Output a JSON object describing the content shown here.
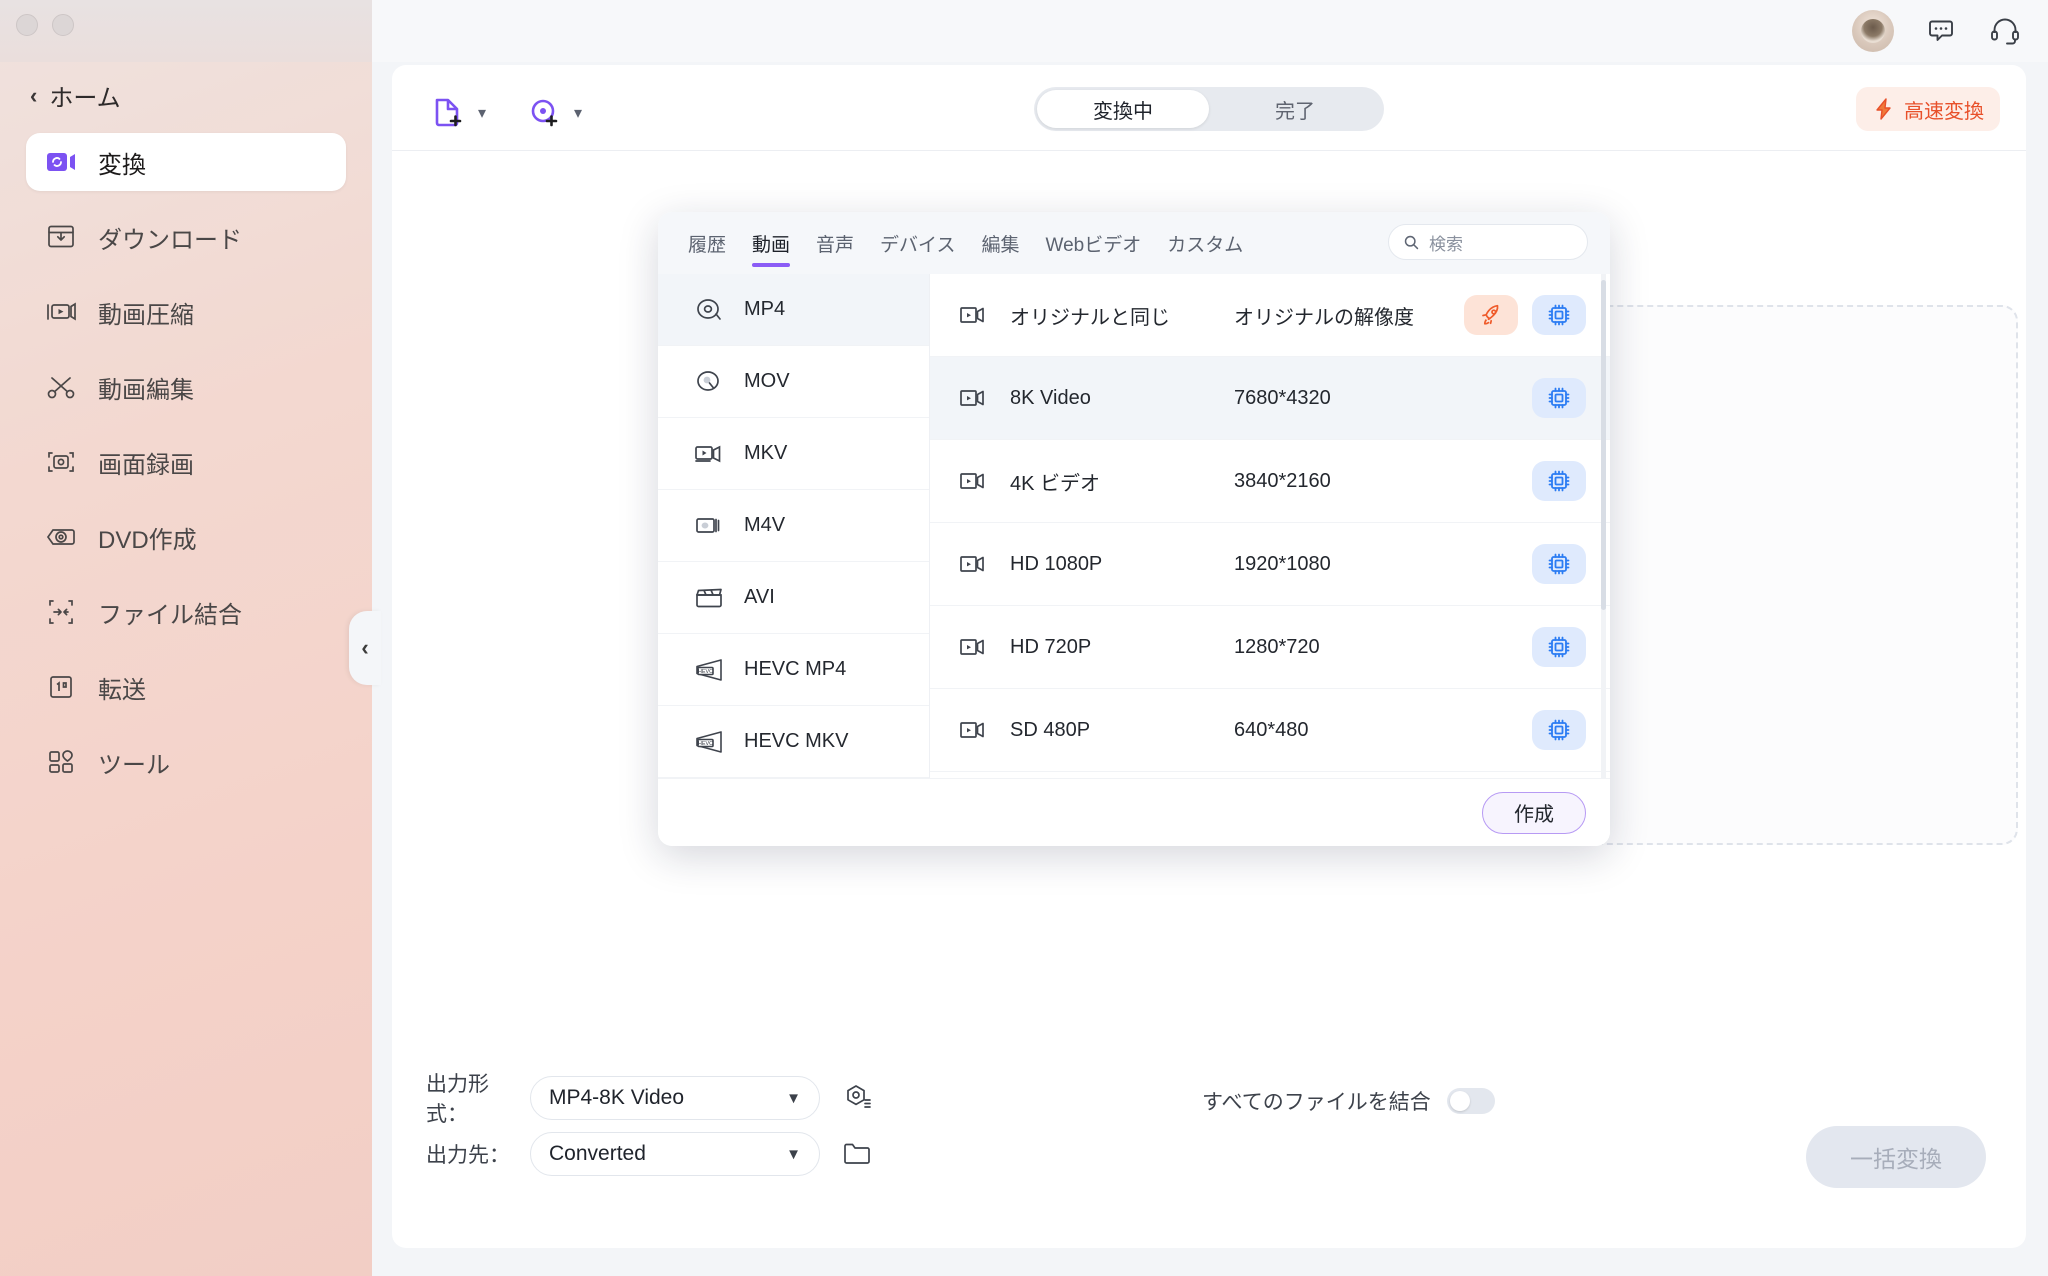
{
  "sidebar": {
    "back_label": "ホーム",
    "items": [
      {
        "label": "変換",
        "icon": "convert-icon",
        "active": true
      },
      {
        "label": "ダウンロード",
        "icon": "download-icon",
        "active": false
      },
      {
        "label": "動画圧縮",
        "icon": "compress-icon",
        "active": false
      },
      {
        "label": "動画編集",
        "icon": "scissors-icon",
        "active": false
      },
      {
        "label": "画面録画",
        "icon": "record-icon",
        "active": false
      },
      {
        "label": "DVD作成",
        "icon": "dvd-icon",
        "active": false
      },
      {
        "label": "ファイル結合",
        "icon": "merge-icon",
        "active": false
      },
      {
        "label": "転送",
        "icon": "transfer-icon",
        "active": false
      },
      {
        "label": "ツール",
        "icon": "tools-icon",
        "active": false
      }
    ]
  },
  "topbar": {
    "icons": [
      "avatar",
      "chat-icon",
      "headset-icon"
    ]
  },
  "toolbar": {
    "add_file_label": "add-file",
    "add_folder_label": "add-folder",
    "segments": [
      {
        "label": "変換中",
        "active": true
      },
      {
        "label": "完了",
        "active": false
      }
    ],
    "fast_convert_label": "高速変換"
  },
  "dialog": {
    "tabs": [
      {
        "label": "履歴",
        "active": false
      },
      {
        "label": "動画",
        "active": true
      },
      {
        "label": "音声",
        "active": false
      },
      {
        "label": "デバイス",
        "active": false
      },
      {
        "label": "編集",
        "active": false
      },
      {
        "label": "Webビデオ",
        "active": false
      },
      {
        "label": "カスタム",
        "active": false
      }
    ],
    "search_placeholder": "検索",
    "formats": [
      {
        "label": "MP4",
        "icon": "disc-icon",
        "active": true
      },
      {
        "label": "MOV",
        "icon": "mov-icon",
        "active": false
      },
      {
        "label": "MKV",
        "icon": "camcorder-icon",
        "active": false
      },
      {
        "label": "M4V",
        "icon": "m4v-icon",
        "active": false
      },
      {
        "label": "AVI",
        "icon": "clapper-icon",
        "active": false
      },
      {
        "label": "HEVC MP4",
        "icon": "hevc-icon",
        "active": false
      },
      {
        "label": "HEVC MKV",
        "icon": "hevc-icon",
        "active": false
      }
    ],
    "resolutions": [
      {
        "name": "オリジナルと同じ",
        "dimensions": "オリジナルの解像度",
        "rocket": true,
        "chip": true,
        "active": false
      },
      {
        "name": "8K Video",
        "dimensions": "7680*4320",
        "rocket": false,
        "chip": true,
        "active": true
      },
      {
        "name": "4K ビデオ",
        "dimensions": "3840*2160",
        "rocket": false,
        "chip": true,
        "active": false
      },
      {
        "name": "HD 1080P",
        "dimensions": "1920*1080",
        "rocket": false,
        "chip": true,
        "active": false
      },
      {
        "name": "HD 720P",
        "dimensions": "1280*720",
        "rocket": false,
        "chip": true,
        "active": false
      },
      {
        "name": "SD 480P",
        "dimensions": "640*480",
        "rocket": false,
        "chip": true,
        "active": false
      }
    ],
    "create_label": "作成"
  },
  "options": {
    "output_format_label": "出力形式：",
    "output_format_value": "MP4-8K Video",
    "output_dest_label": "出力先：",
    "output_dest_value": "Converted",
    "merge_label": "すべてのファイルを結合",
    "merge_on": false,
    "convert_all_label": "一括変換"
  },
  "colors": {
    "accent_purple": "#8b5cf6",
    "accent_orange": "#e8502a",
    "accent_blue": "#2b7cf3",
    "sidebar_pink": "#f3d2c9"
  }
}
